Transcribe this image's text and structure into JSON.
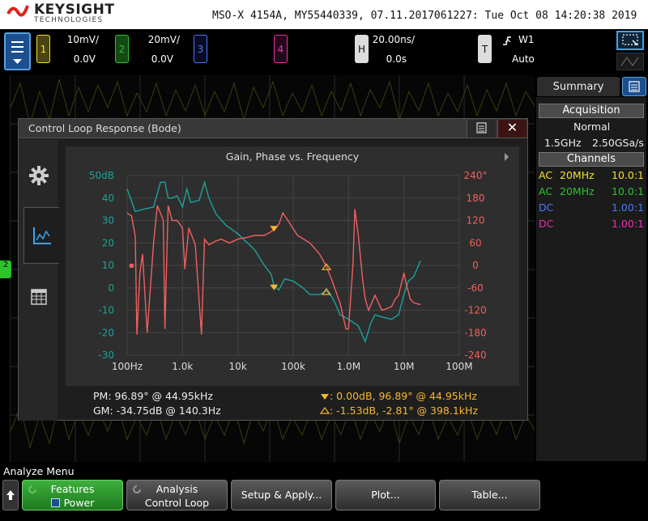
{
  "header": {
    "brand_name": "KEYSIGHT",
    "brand_sub": "TECHNOLOGIES",
    "instrument_info": "MSO-X 4154A, MY55440339, 07.11.2017061227: Tue Oct 08 14:20:38 2019"
  },
  "channels": [
    {
      "num": "1",
      "scale": "10mV/",
      "offset": "0.0V",
      "color": "#f3e22a"
    },
    {
      "num": "2",
      "scale": "20mV/",
      "offset": "0.0V",
      "color": "#2bc42b"
    },
    {
      "num": "3",
      "color": "#4a78ff"
    },
    {
      "num": "4",
      "color": "#f02eb0"
    }
  ],
  "horizontal": {
    "label": "H",
    "timebase": "20.00ns/",
    "delay": "0.0s"
  },
  "trigger": {
    "label": "T",
    "source": "W1",
    "mode": "Auto"
  },
  "ch2_marker": "2",
  "summary": {
    "tab_label": "Summary",
    "acq_header": "Acquisition",
    "acq_mode": "Normal",
    "bandwidth": "1.5GHz",
    "sample_rate": "2.50GSa/s",
    "channels_header": "Channels",
    "rows": [
      {
        "coupling": "AC",
        "bw": "20MHz",
        "probe": "10.0:1",
        "color": "#f3e22a"
      },
      {
        "coupling": "AC",
        "bw": "20MHz",
        "probe": "10.0:1",
        "color": "#2bc42b"
      },
      {
        "coupling": "DC",
        "bw": "",
        "probe": "1.00:1",
        "color": "#4a78ff"
      },
      {
        "coupling": "DC",
        "bw": "",
        "probe": "1.00:1",
        "color": "#f02eb0"
      }
    ]
  },
  "dialog": {
    "title": "Control Loop Response (Bode)",
    "close_label": "✕"
  },
  "chart_data": {
    "type": "line",
    "title": "Gain, Phase vs. Frequency",
    "x_scale": "log",
    "x_ticks": [
      "100Hz",
      "1.0k",
      "10k",
      "100k",
      "1.0M",
      "10M",
      "100M"
    ],
    "x_range": [
      100,
      100000000
    ],
    "y_left_ticks": [
      "50dB",
      "40",
      "30",
      "20",
      "10",
      "0",
      "-10",
      "-20",
      "-30"
    ],
    "y_left_range": [
      -30,
      50
    ],
    "y_right_ticks": [
      "240°",
      "180",
      "120",
      "60",
      "0",
      "-60",
      "-120",
      "-180",
      "-240"
    ],
    "y_right_range": [
      -240,
      240
    ],
    "grid": true,
    "series": [
      {
        "axis": "left",
        "color": "#1aa39a",
        "points": [
          [
            100,
            44
          ],
          [
            140,
            34
          ],
          [
            200,
            35
          ],
          [
            300,
            36
          ],
          [
            400,
            47
          ],
          [
            480,
            47
          ],
          [
            550,
            40
          ],
          [
            650,
            40
          ],
          [
            800,
            41
          ],
          [
            1000,
            36
          ],
          [
            1200,
            44
          ],
          [
            1400,
            38
          ],
          [
            2000,
            39
          ],
          [
            2500,
            47
          ],
          [
            3000,
            40
          ],
          [
            4000,
            33
          ],
          [
            6000,
            28
          ],
          [
            10000,
            24
          ],
          [
            20000,
            17
          ],
          [
            30000,
            10
          ],
          [
            40000,
            6
          ],
          [
            45000,
            1
          ],
          [
            55000,
            -1
          ],
          [
            70000,
            4
          ],
          [
            100000,
            3
          ],
          [
            150000,
            0
          ],
          [
            200000,
            -3
          ],
          [
            300000,
            -3
          ],
          [
            398100,
            -1.5
          ],
          [
            500000,
            -4
          ],
          [
            600000,
            -8
          ],
          [
            700000,
            -12
          ],
          [
            1000000,
            -14
          ],
          [
            1500000,
            -17
          ],
          [
            2000000,
            -24
          ],
          [
            2500000,
            -16
          ],
          [
            3000000,
            -12
          ],
          [
            4000000,
            -13
          ],
          [
            6000000,
            -14
          ],
          [
            8000000,
            -12
          ],
          [
            10000000,
            -3
          ],
          [
            12000000,
            3
          ],
          [
            15000000,
            5
          ],
          [
            20000000,
            12
          ]
        ]
      },
      {
        "axis": "right",
        "color": "#f06060",
        "points": [
          [
            100,
            140
          ],
          [
            120,
            132
          ],
          [
            140,
            78
          ],
          [
            150,
            -185
          ],
          [
            170,
            -20
          ],
          [
            190,
            30
          ],
          [
            230,
            -180
          ],
          [
            300,
            60
          ],
          [
            350,
            160
          ],
          [
            400,
            140
          ],
          [
            450,
            120
          ],
          [
            480,
            -170
          ],
          [
            550,
            160
          ],
          [
            650,
            120
          ],
          [
            800,
            120
          ],
          [
            1000,
            100
          ],
          [
            1100,
            -10
          ],
          [
            1300,
            100
          ],
          [
            1700,
            55
          ],
          [
            2200,
            -185
          ],
          [
            2500,
            70
          ],
          [
            3000,
            55
          ],
          [
            4000,
            65
          ],
          [
            5000,
            70
          ],
          [
            7000,
            60
          ],
          [
            10000,
            70
          ],
          [
            15000,
            75
          ],
          [
            20000,
            80
          ],
          [
            30000,
            80
          ],
          [
            40000,
            90
          ],
          [
            44950,
            96.89
          ],
          [
            55000,
            110
          ],
          [
            65000,
            140
          ],
          [
            80000,
            120
          ],
          [
            120000,
            80
          ],
          [
            200000,
            60
          ],
          [
            300000,
            30
          ],
          [
            398100,
            -2.81
          ],
          [
            500000,
            -40
          ],
          [
            700000,
            -100
          ],
          [
            900000,
            -170
          ],
          [
            1000000,
            -170
          ],
          [
            1200000,
            0
          ],
          [
            1300000,
            150
          ],
          [
            1500000,
            80
          ],
          [
            1800000,
            -40
          ],
          [
            2000000,
            -90
          ],
          [
            2300000,
            -120
          ],
          [
            3000000,
            -80
          ],
          [
            4000000,
            -120
          ],
          [
            5000000,
            -115
          ],
          [
            6000000,
            -110
          ],
          [
            7000000,
            -90
          ],
          [
            8000000,
            -80
          ],
          [
            10000000,
            -20
          ],
          [
            11000000,
            -50
          ],
          [
            13000000,
            -90
          ],
          [
            15000000,
            -100
          ],
          [
            20000000,
            -105
          ]
        ]
      }
    ],
    "markers": [
      {
        "freq": 44950,
        "gain": 0,
        "phase": 96.89,
        "color": "#f5b731",
        "style": "filled"
      },
      {
        "freq": 398100,
        "gain": -1.53,
        "phase": -2.81,
        "color": "#f5b731",
        "style": "hollow"
      }
    ]
  },
  "measurements": {
    "pm": "PM:  96.89° @ 44.95kHz",
    "gm": "GM:  -34.75dB @ 140.3Hz",
    "m1": ":  0.00dB, 96.89° @ 44.95kHz",
    "m2": ":  -1.53dB, -2.81° @ 398.1kHz"
  },
  "softkeys": {
    "menu_title": "Analyze Menu",
    "features_label": "Features",
    "features_value": "Power",
    "analysis_label": "Analysis",
    "analysis_value": "Control Loop",
    "setup_label": "Setup & Apply...",
    "plot_label": "Plot...",
    "table_label": "Table..."
  }
}
